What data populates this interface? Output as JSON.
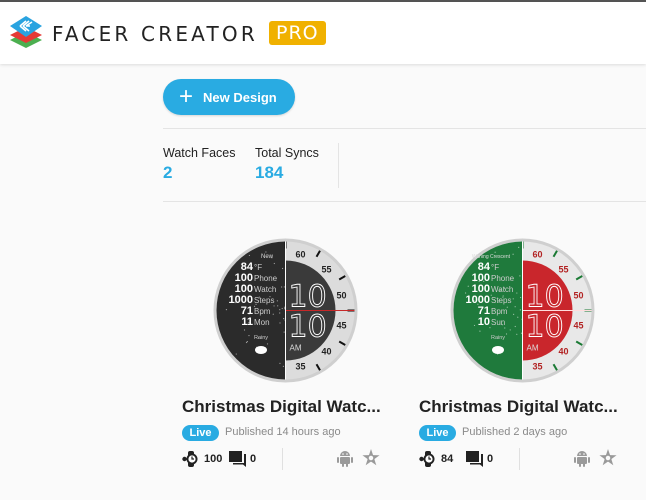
{
  "header": {
    "brand": "FACER CREATOR",
    "badge": "PRO",
    "logo_icon": "facer-layers-logo-icon"
  },
  "toolbar": {
    "new_design_label": "New Design",
    "new_design_icon": "plus-icon"
  },
  "stats": [
    {
      "label": "Watch Faces",
      "value": "2"
    },
    {
      "label": "Total Syncs",
      "value": "184"
    }
  ],
  "colors": {
    "accent": "#29abe2",
    "pro_badge": "#f0b100",
    "muted_text": "#8a8a8a"
  },
  "designs": [
    {
      "title": "Christmas Digital Watc...",
      "status": "Live",
      "published": "Published 14 hours ago",
      "syncs": "100",
      "comments": "0",
      "platforms": [
        "android-icon",
        "tizen-icon"
      ],
      "face": {
        "theme": "dark",
        "moon_text": "New",
        "rows": [
          [
            "84",
            "°F"
          ],
          [
            "100",
            "Phone"
          ],
          [
            "100",
            "Watch"
          ],
          [
            "1000",
            "Steps"
          ],
          [
            "71",
            "Bpm"
          ],
          [
            "11",
            "Mon"
          ]
        ],
        "weather": "Rainy",
        "hour": "10",
        "minute": "10",
        "ampm": "AM",
        "scale": [
          "60",
          "55",
          "50",
          "45",
          "40",
          "35"
        ]
      }
    },
    {
      "title": "Christmas Digital Watc...",
      "status": "Live",
      "published": "Published 2 days ago",
      "syncs": "84",
      "comments": "0",
      "platforms": [
        "android-icon",
        "tizen-icon"
      ],
      "face": {
        "theme": "christmas",
        "moon_text": "Waning Crescent",
        "rows": [
          [
            "84",
            "°F"
          ],
          [
            "100",
            "Phone"
          ],
          [
            "100",
            "Watch"
          ],
          [
            "1000",
            "Steps"
          ],
          [
            "71",
            "Bpm"
          ],
          [
            "10",
            "Sun"
          ]
        ],
        "weather": "Rainy",
        "hour": "10",
        "minute": "10",
        "ampm": "AM",
        "scale": [
          "60",
          "55",
          "50",
          "45",
          "40",
          "35"
        ]
      }
    }
  ]
}
